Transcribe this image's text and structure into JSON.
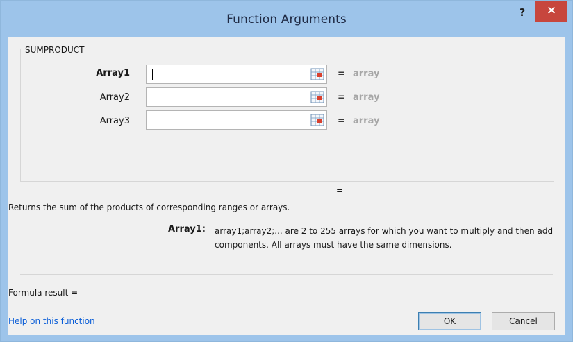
{
  "window": {
    "title": "Function Arguments",
    "help_label": "?",
    "close_label": "×"
  },
  "function": {
    "name": "SUMPRODUCT"
  },
  "arguments": [
    {
      "label": "Array1",
      "value": "",
      "result": "array",
      "active": true
    },
    {
      "label": "Array2",
      "value": "",
      "result": "array",
      "active": false
    },
    {
      "label": "Array3",
      "value": "",
      "result": "array",
      "active": false
    }
  ],
  "overall_equals": "=",
  "description": "Returns the sum of the products of corresponding ranges or arrays.",
  "arg_help": {
    "label": "Array1:",
    "text": "array1;array2;... are 2 to 255 arrays for which you want to multiply and then add components. All arrays must have the same dimensions."
  },
  "formula_result_label": "Formula result =",
  "help_link": "Help on this function",
  "buttons": {
    "ok": "OK",
    "cancel": "Cancel"
  },
  "colors": {
    "titlebar": "#9dc4ea",
    "close_button": "#c7463d",
    "link": "#0b5ed7"
  }
}
